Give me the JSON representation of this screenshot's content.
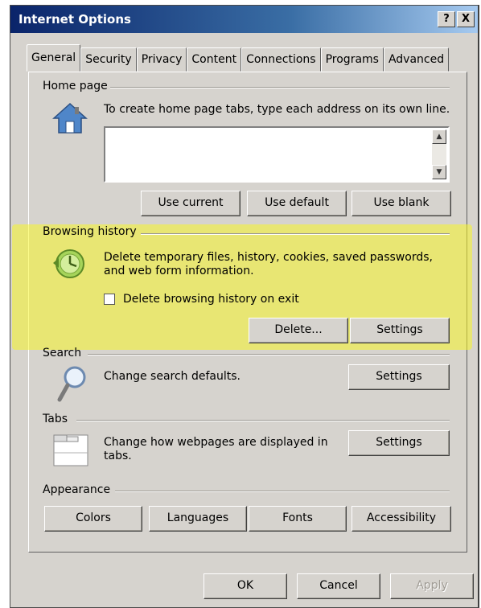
{
  "window": {
    "title": "Internet Options",
    "help_label": "?",
    "close_label": "X"
  },
  "tabs": [
    {
      "label": "General",
      "active": true
    },
    {
      "label": "Security"
    },
    {
      "label": "Privacy"
    },
    {
      "label": "Content"
    },
    {
      "label": "Connections"
    },
    {
      "label": "Programs"
    },
    {
      "label": "Advanced"
    }
  ],
  "home_page": {
    "title": "Home page",
    "description": "To create home page tabs, type each address on its own line.",
    "urls_value": "",
    "buttons": {
      "use_current": "Use current",
      "use_default": "Use default",
      "use_blank": "Use blank"
    },
    "icon": "house-icon"
  },
  "browsing_history": {
    "title": "Browsing history",
    "description_line1": "Delete temporary files, history, cookies, saved passwords,",
    "description_line2": "and web form information.",
    "checkbox_label": "Delete browsing history on exit",
    "checkbox_checked": false,
    "delete_label": "Delete...",
    "settings_label": "Settings",
    "icon": "history-clock-icon",
    "highlight_color": "#f8f528"
  },
  "search": {
    "title": "Search",
    "description": "Change search defaults.",
    "settings_label": "Settings",
    "icon": "magnifier-icon"
  },
  "tabs_section": {
    "title": "Tabs",
    "description_line1": "Change how webpages are displayed in",
    "description_line2": "tabs.",
    "settings_label": "Settings",
    "icon": "tabs-window-icon"
  },
  "appearance": {
    "title": "Appearance",
    "colors_label": "Colors",
    "languages_label": "Languages",
    "fonts_label": "Fonts",
    "accessibility_label": "Accessibility"
  },
  "footer": {
    "ok_label": "OK",
    "cancel_label": "Cancel",
    "apply_label": "Apply"
  }
}
